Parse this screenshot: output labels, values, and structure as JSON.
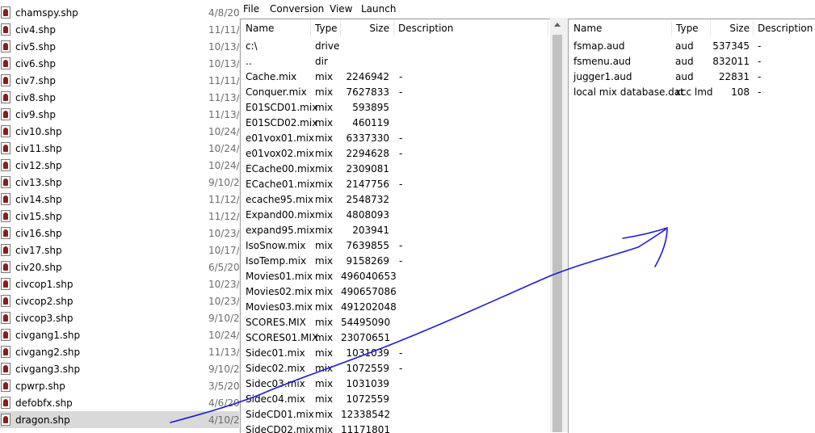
{
  "explorer": {
    "files": [
      {
        "name": "chamspy.shp",
        "date": "4/8/20"
      },
      {
        "name": "civ4.shp",
        "date": "11/11/"
      },
      {
        "name": "civ5.shp",
        "date": "10/13/"
      },
      {
        "name": "civ6.shp",
        "date": "10/13/"
      },
      {
        "name": "civ7.shp",
        "date": "11/11/"
      },
      {
        "name": "civ8.shp",
        "date": "11/13/"
      },
      {
        "name": "civ9.shp",
        "date": "11/13/"
      },
      {
        "name": "civ10.shp",
        "date": "10/24/"
      },
      {
        "name": "civ11.shp",
        "date": "10/24/"
      },
      {
        "name": "civ12.shp",
        "date": "10/24/"
      },
      {
        "name": "civ13.shp",
        "date": "9/10/2"
      },
      {
        "name": "civ14.shp",
        "date": "11/12/"
      },
      {
        "name": "civ15.shp",
        "date": "11/12/"
      },
      {
        "name": "civ16.shp",
        "date": "10/23/"
      },
      {
        "name": "civ17.shp",
        "date": "10/17/"
      },
      {
        "name": "civ20.shp",
        "date": "6/5/20"
      },
      {
        "name": "civcop1.shp",
        "date": "10/23/"
      },
      {
        "name": "civcop2.shp",
        "date": "10/23/"
      },
      {
        "name": "civcop3.shp",
        "date": "9/10/2"
      },
      {
        "name": "civgang1.shp",
        "date": "10/24/"
      },
      {
        "name": "civgang2.shp",
        "date": "11/13/"
      },
      {
        "name": "civgang3.shp",
        "date": "9/10/2"
      },
      {
        "name": "cpwrp.shp",
        "date": "3/5/20"
      },
      {
        "name": "defobfx.shp",
        "date": "4/6/20"
      },
      {
        "name": "dragon.shp",
        "date": "4/10/2",
        "selected": true
      }
    ]
  },
  "menu": {
    "file": "File",
    "conversion": "Conversion",
    "view": "View",
    "launch": "Launch"
  },
  "left_pane": {
    "headers": {
      "name": "Name",
      "type": "Type",
      "size": "Size",
      "description": "Description"
    },
    "rows": [
      {
        "name": "c:\\",
        "type": "drive",
        "size": "",
        "desc": ""
      },
      {
        "name": "..",
        "type": "dir",
        "size": "",
        "desc": ""
      },
      {
        "name": "Cache.mix",
        "type": "mix",
        "size": "2246942",
        "desc": "-"
      },
      {
        "name": "Conquer.mix",
        "type": "mix",
        "size": "7627833",
        "desc": "-"
      },
      {
        "name": "E01SCD01.mix",
        "type": "mix",
        "size": "593895",
        "desc": ""
      },
      {
        "name": "E01SCD02.mix",
        "type": "mix",
        "size": "460119",
        "desc": ""
      },
      {
        "name": "e01vox01.mix",
        "type": "mix",
        "size": "6337330",
        "desc": "-"
      },
      {
        "name": "e01vox02.mix",
        "type": "mix",
        "size": "2294628",
        "desc": "-"
      },
      {
        "name": "ECache00.mix",
        "type": "mix",
        "size": "2309081",
        "desc": ""
      },
      {
        "name": "ECache01.mix",
        "type": "mix",
        "size": "2147756",
        "desc": "-"
      },
      {
        "name": "ecache95.mix",
        "type": "mix",
        "size": "2548732",
        "desc": ""
      },
      {
        "name": "Expand00.mix",
        "type": "mix",
        "size": "4808093",
        "desc": ""
      },
      {
        "name": "expand95.mix",
        "type": "mix",
        "size": "203941",
        "desc": ""
      },
      {
        "name": "IsoSnow.mix",
        "type": "mix",
        "size": "7639855",
        "desc": "-"
      },
      {
        "name": "IsoTemp.mix",
        "type": "mix",
        "size": "9158269",
        "desc": "-"
      },
      {
        "name": "Movies01.mix",
        "type": "mix",
        "size": "496040653",
        "desc": ""
      },
      {
        "name": "Movies02.mix",
        "type": "mix",
        "size": "490657086",
        "desc": ""
      },
      {
        "name": "Movies03.mix",
        "type": "mix",
        "size": "491202048",
        "desc": ""
      },
      {
        "name": "SCORES.MIX",
        "type": "mix",
        "size": "54495090",
        "desc": ""
      },
      {
        "name": "SCORES01.MIX",
        "type": "mix",
        "size": "23070651",
        "desc": ""
      },
      {
        "name": "Sidec01.mix",
        "type": "mix",
        "size": "1031039",
        "desc": "-"
      },
      {
        "name": "Sidec02.mix",
        "type": "mix",
        "size": "1072559",
        "desc": "-"
      },
      {
        "name": "Sidec03.mix",
        "type": "mix",
        "size": "1031039",
        "desc": ""
      },
      {
        "name": "Sidec04.mix",
        "type": "mix",
        "size": "1072559",
        "desc": ""
      },
      {
        "name": "SideCD01.mix",
        "type": "mix",
        "size": "12338542",
        "desc": ""
      },
      {
        "name": "SideCD02.mix",
        "type": "mix",
        "size": "11171801",
        "desc": ""
      }
    ]
  },
  "right_pane": {
    "headers": {
      "name": "Name",
      "type": "Type",
      "size": "Size",
      "description": "Description"
    },
    "rows": [
      {
        "name": "fsmap.aud",
        "type": "aud",
        "size": "537345",
        "desc": "-"
      },
      {
        "name": "fsmenu.aud",
        "type": "aud",
        "size": "832011",
        "desc": "-"
      },
      {
        "name": "jugger1.aud",
        "type": "aud",
        "size": "22831",
        "desc": "-"
      },
      {
        "name": "local mix database.dat",
        "type": "xcc lmd",
        "size": "108",
        "desc": "-"
      }
    ]
  },
  "annotation": {
    "color": "#1c1cd6"
  }
}
